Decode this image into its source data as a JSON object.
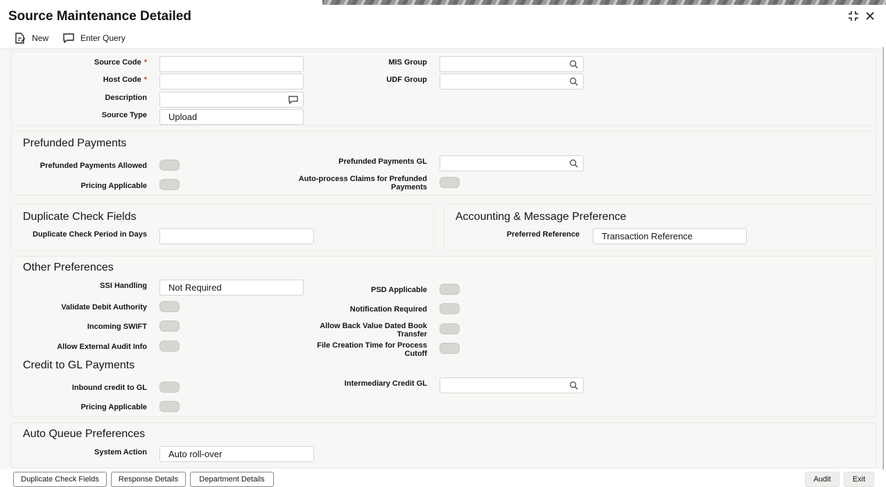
{
  "window": {
    "title": "Source Maintenance Detailed",
    "maximize_glyph": "⛶",
    "close_glyph": "✕"
  },
  "toolbar": {
    "new_label": "New",
    "enter_query_label": "Enter Query"
  },
  "main": {
    "source_code_label": "Source Code",
    "host_code_label": "Host Code",
    "description_label": "Description",
    "source_type_label": "Source Type",
    "source_type_value": "Upload",
    "mis_group_label": "MIS Group",
    "udf_group_label": "UDF Group",
    "required_mark": "*"
  },
  "prefunded": {
    "title": "Prefunded Payments",
    "allowed_label": "Prefunded Payments Allowed",
    "pricing_label": "Pricing Applicable",
    "gl_label": "Prefunded Payments GL",
    "auto_process_label_1": "Auto-process Claims for Prefunded",
    "auto_process_label_2": "Payments"
  },
  "duplicate": {
    "title": "Duplicate Check Fields",
    "period_label": "Duplicate Check Period in Days"
  },
  "accounting": {
    "title": "Accounting & Message Preference",
    "preferred_ref_label": "Preferred Reference",
    "preferred_ref_value": "Transaction Reference"
  },
  "other": {
    "title": "Other Preferences",
    "ssi_label": "SSI Handling",
    "ssi_value": "Not Required",
    "validate_debit_label": "Validate Debit Authority",
    "incoming_swift_label": "Incoming SWIFT",
    "external_audit_label": "Allow External Audit Info",
    "psd_label": "PSD Applicable",
    "notification_label": "Notification Required",
    "back_value_label_1": "Allow Back Value Dated Book",
    "back_value_label_2": "Transfer",
    "file_creation_label_1": "File Creation Time for Process",
    "file_creation_label_2": "Cutoff"
  },
  "credit_gl": {
    "title": "Credit to GL Payments",
    "inbound_label": "Inbound credit to GL",
    "pricing_label": "Pricing Applicable",
    "intermediary_label": "Intermediary Credit GL"
  },
  "auto_queue": {
    "title": "Auto Queue Preferences",
    "system_action_label": "System Action",
    "system_action_value": "Auto roll-over"
  },
  "footer": {
    "duplicate_btn": "Duplicate Check Fields",
    "response_btn": "Response Details",
    "department_btn": "Department Details",
    "audit_btn": "Audit",
    "exit_btn": "Exit"
  },
  "colors": {
    "accent_required": "#c74634",
    "panel_bg": "#f8f7f5",
    "toggle_off": "#d8d6d3"
  }
}
